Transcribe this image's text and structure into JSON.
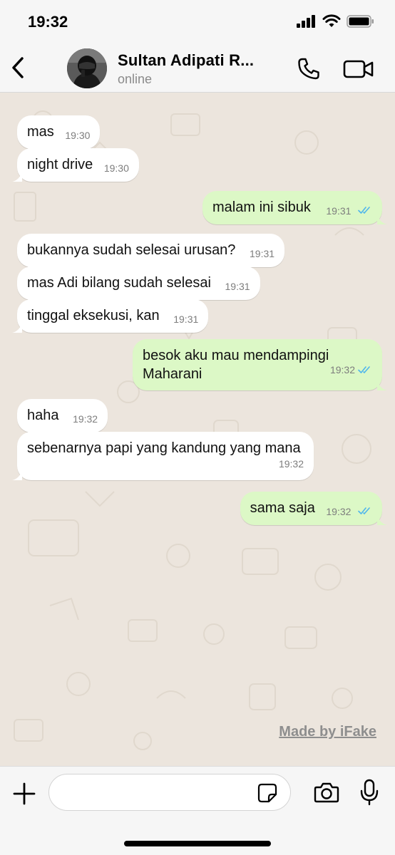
{
  "status_bar": {
    "time": "19:32"
  },
  "header": {
    "contact_name": "Sultan Adipati R...",
    "contact_status": "online"
  },
  "messages": [
    {
      "direction": "in",
      "text": "mas",
      "time": "19:30"
    },
    {
      "direction": "in",
      "text": "night drive",
      "time": "19:30"
    },
    {
      "direction": "out",
      "text": "malam ini sibuk",
      "time": "19:31",
      "read": true
    },
    {
      "direction": "in",
      "text": "bukannya sudah selesai urusan?",
      "time": "19:31"
    },
    {
      "direction": "in",
      "text": "mas Adi bilang sudah selesai",
      "time": "19:31"
    },
    {
      "direction": "in",
      "text": "tinggal eksekusi, kan",
      "time": "19:31"
    },
    {
      "direction": "out",
      "text": "besok aku mau mendampingi Maharani",
      "time": "19:32",
      "read": true
    },
    {
      "direction": "in",
      "text": "haha",
      "time": "19:32"
    },
    {
      "direction": "in",
      "text": "sebenarnya papi yang kandung yang mana",
      "time": "19:32"
    },
    {
      "direction": "out",
      "text": "sama saja",
      "time": "19:32",
      "read": true
    }
  ],
  "watermark": "Made by iFake",
  "input": {
    "value": "",
    "placeholder": ""
  },
  "icons": {
    "back": "chevron-left-icon",
    "call": "phone-icon",
    "video": "video-camera-icon",
    "plus": "plus-icon",
    "sticker": "sticker-icon",
    "camera": "camera-icon",
    "mic": "microphone-icon"
  },
  "colors": {
    "chat_background": "#ece5dd",
    "outgoing_bubble": "#dcf8c6",
    "incoming_bubble": "#ffffff",
    "read_ticks": "#4fb6ec"
  }
}
